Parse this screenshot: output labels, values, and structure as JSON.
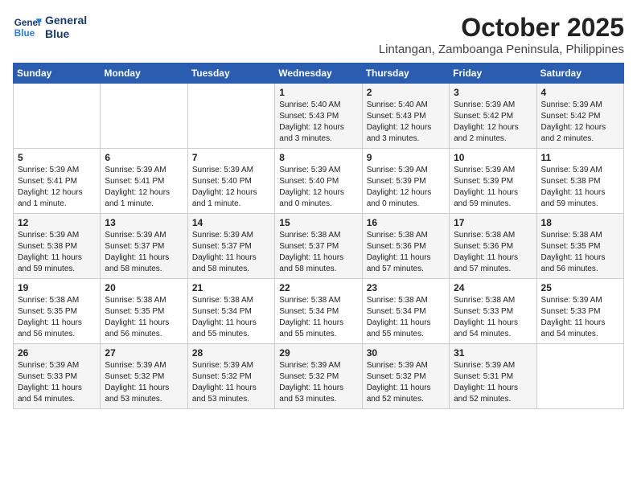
{
  "header": {
    "logo_line1": "General",
    "logo_line2": "Blue",
    "month": "October 2025",
    "location": "Lintangan, Zamboanga Peninsula, Philippines"
  },
  "weekdays": [
    "Sunday",
    "Monday",
    "Tuesday",
    "Wednesday",
    "Thursday",
    "Friday",
    "Saturday"
  ],
  "weeks": [
    [
      {
        "day": "",
        "text": ""
      },
      {
        "day": "",
        "text": ""
      },
      {
        "day": "",
        "text": ""
      },
      {
        "day": "1",
        "text": "Sunrise: 5:40 AM\nSunset: 5:43 PM\nDaylight: 12 hours\nand 3 minutes."
      },
      {
        "day": "2",
        "text": "Sunrise: 5:40 AM\nSunset: 5:43 PM\nDaylight: 12 hours\nand 3 minutes."
      },
      {
        "day": "3",
        "text": "Sunrise: 5:39 AM\nSunset: 5:42 PM\nDaylight: 12 hours\nand 2 minutes."
      },
      {
        "day": "4",
        "text": "Sunrise: 5:39 AM\nSunset: 5:42 PM\nDaylight: 12 hours\nand 2 minutes."
      }
    ],
    [
      {
        "day": "5",
        "text": "Sunrise: 5:39 AM\nSunset: 5:41 PM\nDaylight: 12 hours\nand 1 minute."
      },
      {
        "day": "6",
        "text": "Sunrise: 5:39 AM\nSunset: 5:41 PM\nDaylight: 12 hours\nand 1 minute."
      },
      {
        "day": "7",
        "text": "Sunrise: 5:39 AM\nSunset: 5:40 PM\nDaylight: 12 hours\nand 1 minute."
      },
      {
        "day": "8",
        "text": "Sunrise: 5:39 AM\nSunset: 5:40 PM\nDaylight: 12 hours\nand 0 minutes."
      },
      {
        "day": "9",
        "text": "Sunrise: 5:39 AM\nSunset: 5:39 PM\nDaylight: 12 hours\nand 0 minutes."
      },
      {
        "day": "10",
        "text": "Sunrise: 5:39 AM\nSunset: 5:39 PM\nDaylight: 11 hours\nand 59 minutes."
      },
      {
        "day": "11",
        "text": "Sunrise: 5:39 AM\nSunset: 5:38 PM\nDaylight: 11 hours\nand 59 minutes."
      }
    ],
    [
      {
        "day": "12",
        "text": "Sunrise: 5:39 AM\nSunset: 5:38 PM\nDaylight: 11 hours\nand 59 minutes."
      },
      {
        "day": "13",
        "text": "Sunrise: 5:39 AM\nSunset: 5:37 PM\nDaylight: 11 hours\nand 58 minutes."
      },
      {
        "day": "14",
        "text": "Sunrise: 5:39 AM\nSunset: 5:37 PM\nDaylight: 11 hours\nand 58 minutes."
      },
      {
        "day": "15",
        "text": "Sunrise: 5:38 AM\nSunset: 5:37 PM\nDaylight: 11 hours\nand 58 minutes."
      },
      {
        "day": "16",
        "text": "Sunrise: 5:38 AM\nSunset: 5:36 PM\nDaylight: 11 hours\nand 57 minutes."
      },
      {
        "day": "17",
        "text": "Sunrise: 5:38 AM\nSunset: 5:36 PM\nDaylight: 11 hours\nand 57 minutes."
      },
      {
        "day": "18",
        "text": "Sunrise: 5:38 AM\nSunset: 5:35 PM\nDaylight: 11 hours\nand 56 minutes."
      }
    ],
    [
      {
        "day": "19",
        "text": "Sunrise: 5:38 AM\nSunset: 5:35 PM\nDaylight: 11 hours\nand 56 minutes."
      },
      {
        "day": "20",
        "text": "Sunrise: 5:38 AM\nSunset: 5:35 PM\nDaylight: 11 hours\nand 56 minutes."
      },
      {
        "day": "21",
        "text": "Sunrise: 5:38 AM\nSunset: 5:34 PM\nDaylight: 11 hours\nand 55 minutes."
      },
      {
        "day": "22",
        "text": "Sunrise: 5:38 AM\nSunset: 5:34 PM\nDaylight: 11 hours\nand 55 minutes."
      },
      {
        "day": "23",
        "text": "Sunrise: 5:38 AM\nSunset: 5:34 PM\nDaylight: 11 hours\nand 55 minutes."
      },
      {
        "day": "24",
        "text": "Sunrise: 5:38 AM\nSunset: 5:33 PM\nDaylight: 11 hours\nand 54 minutes."
      },
      {
        "day": "25",
        "text": "Sunrise: 5:39 AM\nSunset: 5:33 PM\nDaylight: 11 hours\nand 54 minutes."
      }
    ],
    [
      {
        "day": "26",
        "text": "Sunrise: 5:39 AM\nSunset: 5:33 PM\nDaylight: 11 hours\nand 54 minutes."
      },
      {
        "day": "27",
        "text": "Sunrise: 5:39 AM\nSunset: 5:32 PM\nDaylight: 11 hours\nand 53 minutes."
      },
      {
        "day": "28",
        "text": "Sunrise: 5:39 AM\nSunset: 5:32 PM\nDaylight: 11 hours\nand 53 minutes."
      },
      {
        "day": "29",
        "text": "Sunrise: 5:39 AM\nSunset: 5:32 PM\nDaylight: 11 hours\nand 53 minutes."
      },
      {
        "day": "30",
        "text": "Sunrise: 5:39 AM\nSunset: 5:32 PM\nDaylight: 11 hours\nand 52 minutes."
      },
      {
        "day": "31",
        "text": "Sunrise: 5:39 AM\nSunset: 5:31 PM\nDaylight: 11 hours\nand 52 minutes."
      },
      {
        "day": "",
        "text": ""
      }
    ]
  ]
}
